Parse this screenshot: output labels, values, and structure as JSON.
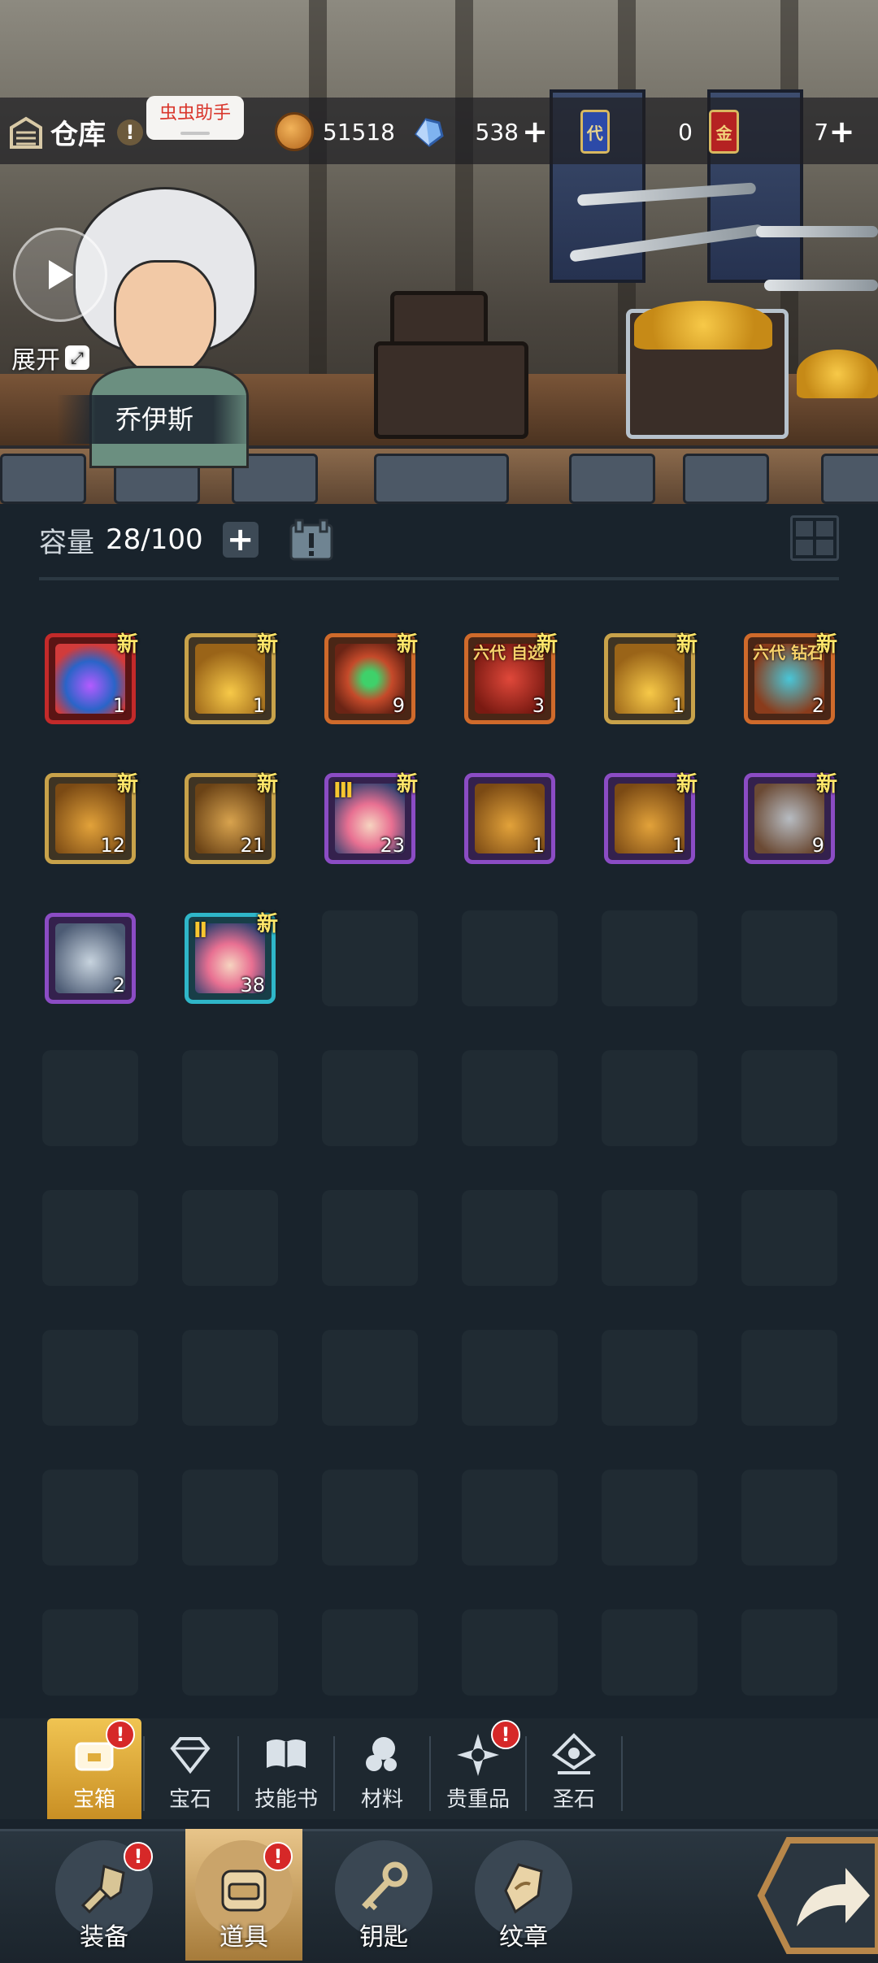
{
  "header": {
    "title": "仓库",
    "alert": "!",
    "assistant_label": "虫虫助手",
    "resources": {
      "coins": "51518",
      "gems": "538",
      "card_blue_char": "代",
      "card_blue": "0",
      "card_red_char": "金",
      "card_red": "7"
    },
    "plus": "+"
  },
  "hero": {
    "name": "乔伊斯",
    "expand_label": "展开"
  },
  "capacity": {
    "label": "容量",
    "value": "28/100",
    "plus": "+"
  },
  "items": [
    {
      "rarity": "red",
      "count": "1",
      "new": "新",
      "icon": "crown-orb-chest-icon"
    },
    {
      "rarity": "gold",
      "count": "1",
      "new": "新",
      "icon": "gold-chest-icon"
    },
    {
      "rarity": "orange",
      "count": "9",
      "new": "新",
      "icon": "ring-emerald-icon"
    },
    {
      "rarity": "orange",
      "count": "3",
      "new": "新",
      "icon": "select-scroll-icon",
      "tag": "六代 自选"
    },
    {
      "rarity": "gold",
      "count": "1",
      "new": "新",
      "icon": "gold-chest-icon"
    },
    {
      "rarity": "orange",
      "count": "2",
      "new": "新",
      "icon": "diamond-box-icon",
      "tag": "六代 钻石"
    },
    {
      "rarity": "gold",
      "count": "12",
      "new": "新",
      "icon": "gold-bag-icon"
    },
    {
      "rarity": "gold",
      "count": "21",
      "new": "新",
      "icon": "bronze-urn-icon"
    },
    {
      "rarity": "purple",
      "count": "23",
      "new": "新",
      "icon": "pouch-icon",
      "roman": "Ⅲ"
    },
    {
      "rarity": "purple",
      "count": "1",
      "new": "",
      "icon": "gold-bag-icon"
    },
    {
      "rarity": "purple",
      "count": "1",
      "new": "新",
      "icon": "gold-bag-icon"
    },
    {
      "rarity": "purple",
      "count": "9",
      "new": "新",
      "icon": "mining-crate-icon"
    },
    {
      "rarity": "purple",
      "count": "2",
      "new": "",
      "icon": "silver-urn-icon"
    },
    {
      "rarity": "cyan",
      "count": "38",
      "new": "新",
      "icon": "pouch-icon",
      "roman": "Ⅱ"
    }
  ],
  "categories": [
    {
      "label": "宝箱",
      "active": true,
      "badge": "!"
    },
    {
      "label": "宝石",
      "active": false
    },
    {
      "label": "技能书",
      "active": false
    },
    {
      "label": "材料",
      "active": false
    },
    {
      "label": "贵重品",
      "active": false,
      "badge": "!"
    },
    {
      "label": "圣石",
      "active": false
    }
  ],
  "nav": [
    {
      "label": "装备",
      "badge": "!"
    },
    {
      "label": "道具",
      "badge": "!",
      "active": true
    },
    {
      "label": "钥匙"
    },
    {
      "label": "纹章"
    }
  ],
  "colors": {
    "background": "#19232c",
    "active_tab": "#e0ad3c",
    "badge": "#d62828",
    "new_tag": "#ffe76a"
  }
}
